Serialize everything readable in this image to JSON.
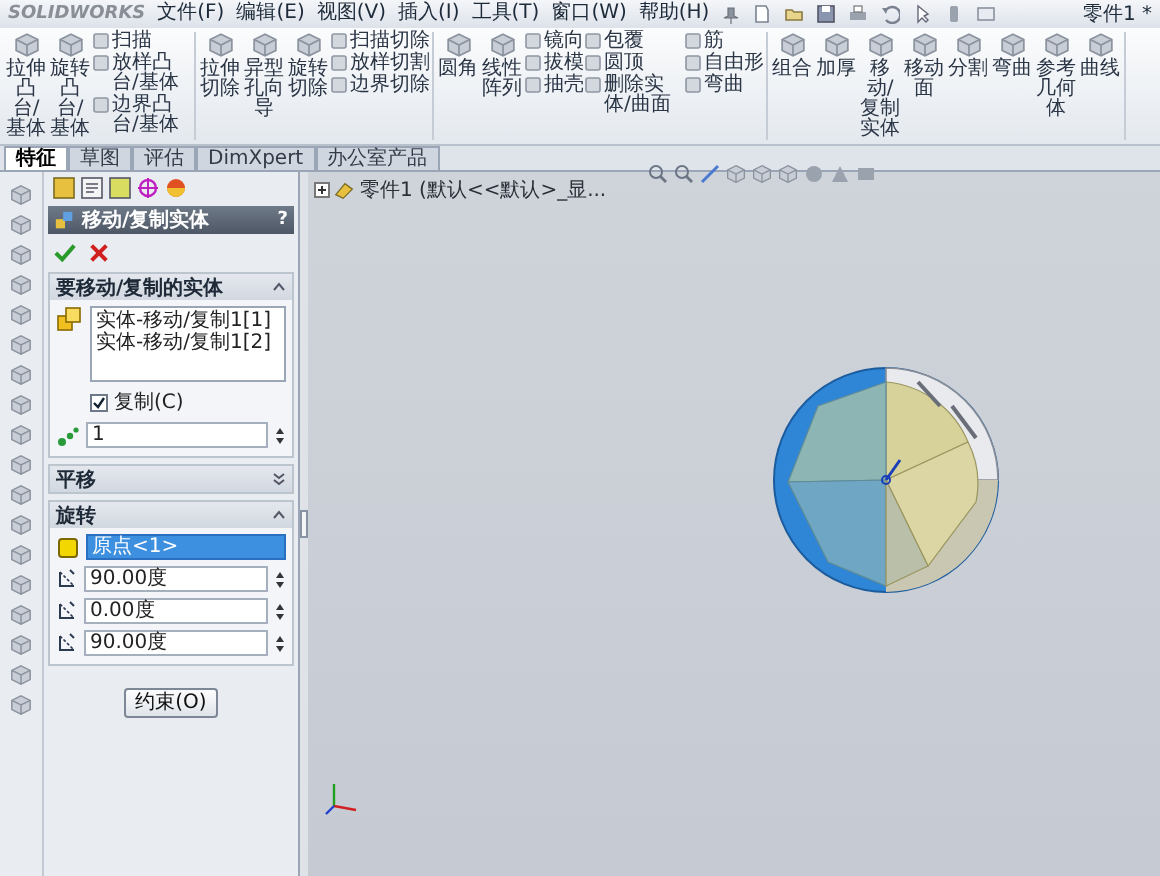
{
  "window": {
    "logo": "SOLIDWORKS",
    "title": "零件1 *"
  },
  "menu": [
    "文件(F)",
    "编辑(E)",
    "视图(V)",
    "插入(I)",
    "工具(T)",
    "窗口(W)",
    "帮助(H)"
  ],
  "ribbon": [
    [
      {
        "kind": "large",
        "label": "拉伸凸台/基体"
      },
      {
        "kind": "large",
        "label": "旋转凸台/基体"
      },
      {
        "kind": "stack",
        "items": [
          "扫描",
          "放样凸台/基体",
          "边界凸台/基体"
        ]
      }
    ],
    [
      {
        "kind": "large",
        "label": "拉伸切除"
      },
      {
        "kind": "large",
        "label": "异型孔向导"
      },
      {
        "kind": "large",
        "label": "旋转切除"
      },
      {
        "kind": "stack",
        "items": [
          "扫描切除",
          "放样切割",
          "边界切除"
        ]
      }
    ],
    [
      {
        "kind": "large",
        "label": "圆角"
      },
      {
        "kind": "large",
        "label": "线性阵列"
      },
      {
        "kind": "stack",
        "items": [
          "镜向",
          "拔模",
          "抽壳"
        ]
      },
      {
        "kind": "stack",
        "items": [
          "包覆",
          "圆顶",
          "删除实体/曲面"
        ]
      },
      {
        "kind": "stack",
        "items": [
          "筋",
          "自由形",
          "弯曲"
        ]
      }
    ],
    [
      {
        "kind": "large",
        "label": "组合"
      },
      {
        "kind": "large",
        "label": "加厚"
      },
      {
        "kind": "large",
        "label": "移动/复制实体"
      },
      {
        "kind": "large",
        "label": "移动面"
      },
      {
        "kind": "large",
        "label": "分割"
      },
      {
        "kind": "large",
        "label": "弯曲"
      },
      {
        "kind": "large",
        "label": "参考几何体"
      },
      {
        "kind": "large",
        "label": "曲线"
      }
    ]
  ],
  "tabs": [
    {
      "label": "特征",
      "selected": true
    },
    {
      "label": "草图",
      "selected": false
    },
    {
      "label": "评估",
      "selected": false
    },
    {
      "label": "DimXpert",
      "selected": false
    },
    {
      "label": "办公室产品",
      "selected": false
    }
  ],
  "property_manager": {
    "title": "移动/复制实体",
    "help": "?",
    "sections": [
      {
        "kind": "bodies",
        "title": "要移动/复制的实体",
        "expanded": true,
        "bodies": [
          "实体-移动/复制1[1]",
          "实体-移动/复制1[2]"
        ],
        "copy": {
          "label": "复制(C)",
          "checked": true
        },
        "copies": "1"
      },
      {
        "kind": "translate",
        "title": "平移",
        "expanded": false
      },
      {
        "kind": "rotate",
        "title": "旋转",
        "expanded": true,
        "reference": {
          "value": "原点<1>",
          "selected": true
        },
        "angles": [
          "90.00度",
          "0.00度",
          "90.00度"
        ]
      }
    ],
    "button": "约束(O)"
  },
  "tree": {
    "root": "零件1 (默认<<默认>_显..."
  }
}
